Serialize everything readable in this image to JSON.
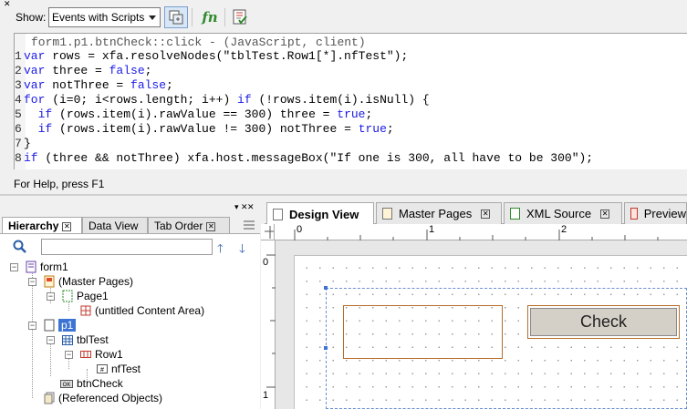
{
  "toolbar": {
    "show_label": "Show:",
    "show_value": "Events with Scripts",
    "fn_label": "fn"
  },
  "editor": {
    "header": "form1.p1.btnCheck::click - (JavaScript, client)",
    "lines": [
      {
        "num": "1",
        "code": "var rows = xfa.resolveNodes(\"tblTest.Row1[*].nfTest\");"
      },
      {
        "num": "2",
        "code": "var three = false;"
      },
      {
        "num": "3",
        "code": "var notThree = false;"
      },
      {
        "num": "4",
        "code": "for (i=0; i<rows.length; i++) if (!rows.item(i).isNull) {"
      },
      {
        "num": "5",
        "code": "  if (rows.item(i).rawValue == 300) three = true;"
      },
      {
        "num": "6",
        "code": "  if (rows.item(i).rawValue != 300) notThree = true;"
      },
      {
        "num": "7",
        "code": "}"
      },
      {
        "num": "8",
        "code": "if (three && notThree) xfa.host.messageBox(\"If one is 300, all have to be 300\");"
      }
    ]
  },
  "status": "For Help, press F1",
  "left_panel": {
    "tabs": [
      "Hierarchy",
      "Data View",
      "Tab Order"
    ],
    "search_placeholder": "",
    "tree": [
      {
        "label": "form1"
      },
      {
        "label": "(Master Pages)"
      },
      {
        "label": "Page1"
      },
      {
        "label": "(untitled Content Area)"
      },
      {
        "label": "p1"
      },
      {
        "label": "tblTest"
      },
      {
        "label": "Row1"
      },
      {
        "label": "nfTest"
      },
      {
        "label": "btnCheck"
      },
      {
        "label": "(Referenced Objects)"
      }
    ]
  },
  "right_panel": {
    "tabs": [
      "Design View",
      "Master Pages",
      "XML Source",
      "Preview"
    ],
    "ruler_h": [
      "0",
      "1",
      "2"
    ],
    "ruler_v": [
      "0",
      "1"
    ],
    "button_caption": "Check"
  },
  "colors": {
    "keyword": "#1a1ae6",
    "selection": "#3d74d4",
    "field_border": "#b56d2a"
  }
}
